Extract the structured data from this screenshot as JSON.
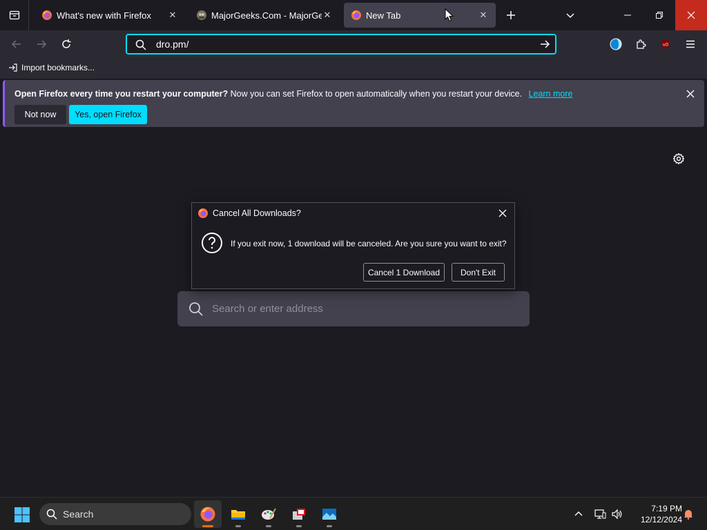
{
  "tabs": [
    {
      "title": "What's new with Firefox",
      "selected": false
    },
    {
      "title": "MajorGeeks.Com - MajorGeeks",
      "selected": false
    },
    {
      "title": "New Tab",
      "selected": true
    }
  ],
  "navbar": {
    "url": "dro.pm/"
  },
  "bookmarks": {
    "import_label": "Import bookmarks..."
  },
  "notification": {
    "bold_text": "Open Firefox every time you restart your computer?",
    "text": "Now you can set Firefox to open automatically when you restart your device.",
    "link": "Learn more",
    "secondary_button": "Not now",
    "primary_button": "Yes, open Firefox"
  },
  "newtab": {
    "search_placeholder": "Search or enter address"
  },
  "dialog": {
    "title": "Cancel All Downloads?",
    "message": "If you exit now, 1 download will be canceled. Are you sure you want to exit?",
    "button_cancel": "Cancel 1 Download",
    "button_dont_exit": "Don't Exit"
  },
  "taskbar": {
    "search_label": "Search",
    "time": "7:19 PM",
    "date": "12/12/2024"
  },
  "colors": {
    "accent": "#00ddff",
    "close_red": "#c42b1c",
    "background": "#1c1b22"
  }
}
